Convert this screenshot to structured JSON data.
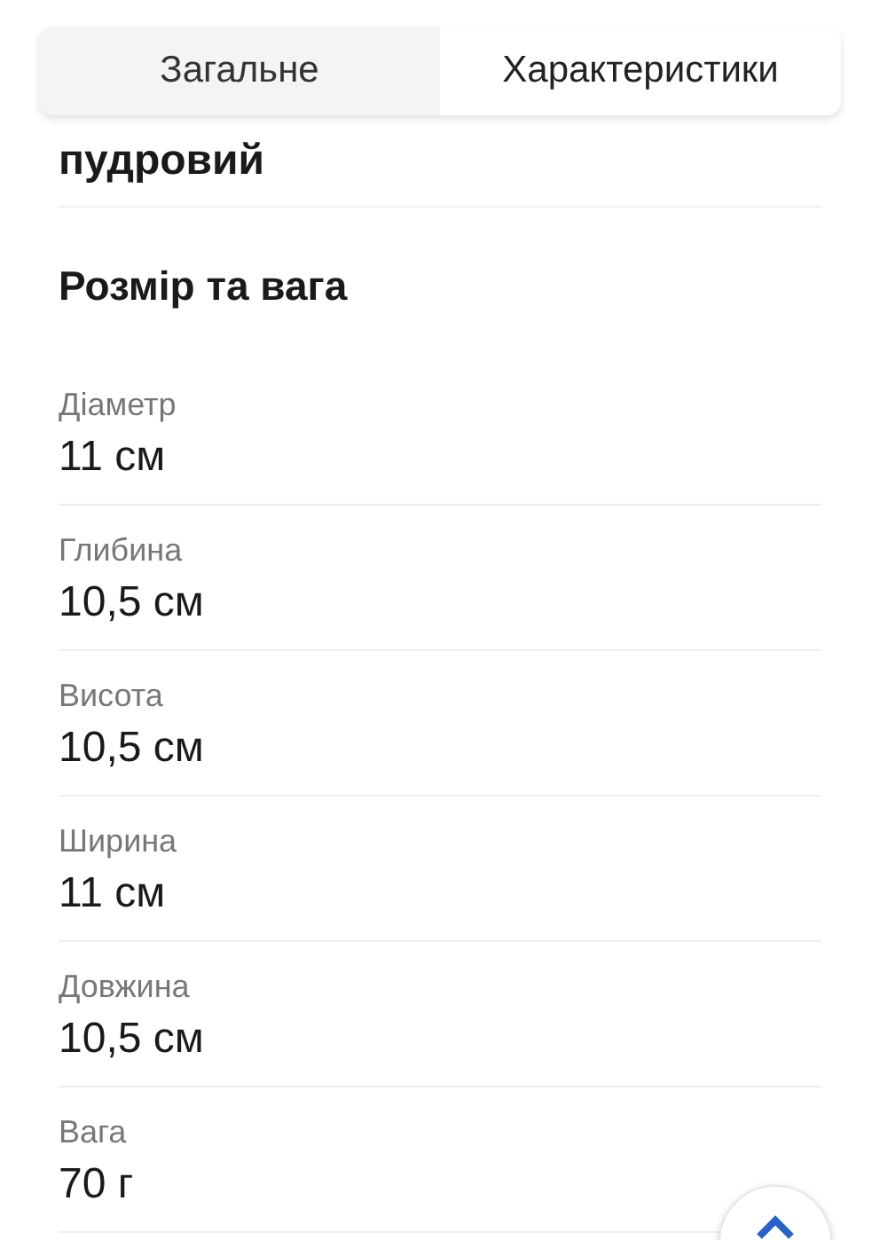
{
  "tabs": [
    {
      "label": "Загальне",
      "selected": false
    },
    {
      "label": "Характеристики",
      "selected": true
    }
  ],
  "previous_value": "пудровий",
  "section_title": "Розмір та вага",
  "specs": [
    {
      "label": "Діаметр",
      "value": "11 см"
    },
    {
      "label": "Глибина",
      "value": "10,5 см"
    },
    {
      "label": "Висота",
      "value": "10,5 см"
    },
    {
      "label": "Ширина",
      "value": "11 см"
    },
    {
      "label": "Довжина",
      "value": "10,5 см"
    },
    {
      "label": "Вага",
      "value": "70 г"
    }
  ]
}
